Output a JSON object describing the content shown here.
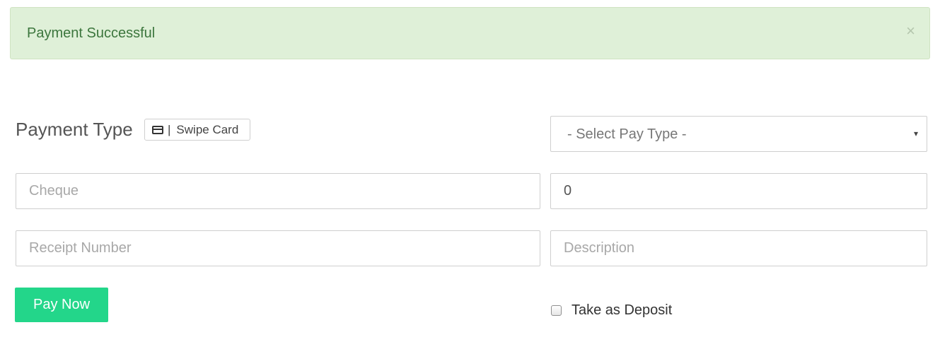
{
  "alert": {
    "message": "Payment Successful",
    "close_glyph": "×"
  },
  "payment_type": {
    "label": "Payment Type",
    "swipe_button": {
      "icon": "credit-card-icon",
      "separator": "|",
      "label": "Swipe Card"
    }
  },
  "pay_type_select": {
    "selected": "- Select Pay Type -",
    "caret": "▾"
  },
  "fields": {
    "cheque": {
      "placeholder": "Cheque",
      "value": ""
    },
    "amount": {
      "placeholder": "",
      "value": "0"
    },
    "receipt_number": {
      "placeholder": "Receipt Number",
      "value": ""
    },
    "description": {
      "placeholder": "Description",
      "value": ""
    }
  },
  "pay_now": {
    "label": "Pay Now",
    "color": "#23d68a"
  },
  "deposit": {
    "label": "Take as Deposit",
    "checked": false
  },
  "colors": {
    "alert_bg": "#dff0d8",
    "alert_text": "#3c763d"
  }
}
